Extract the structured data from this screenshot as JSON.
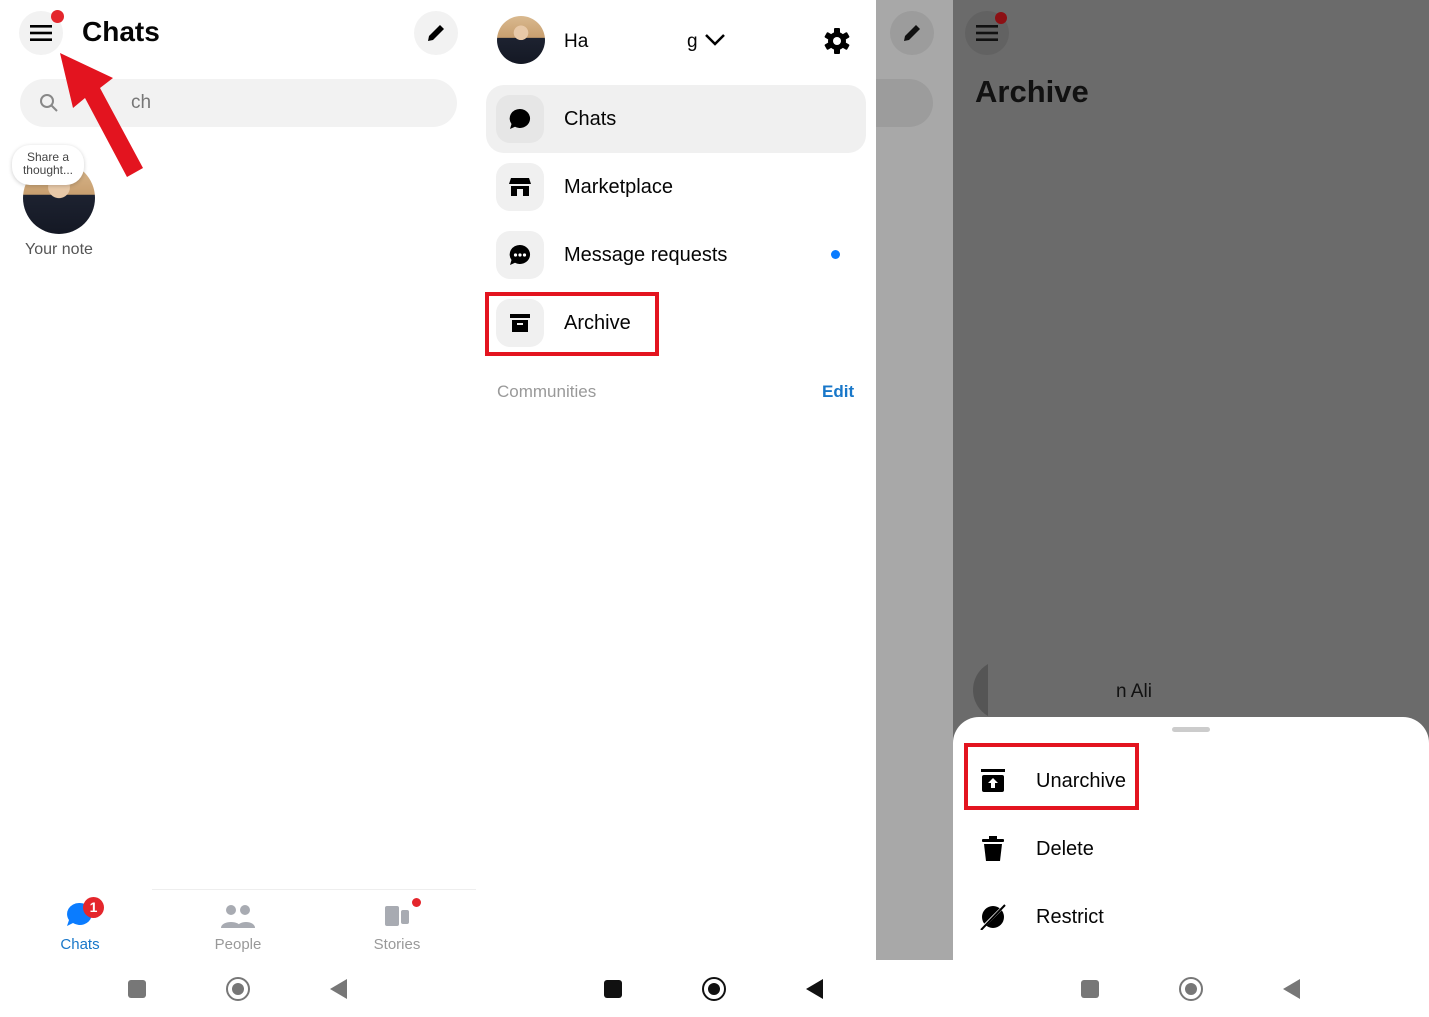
{
  "panel1": {
    "title": "Chats",
    "search_placeholder": "ch",
    "note_bubble": "Share a thought...",
    "note_label": "Your note",
    "tabs": [
      {
        "label": "Chats",
        "badge": "1",
        "active": true
      },
      {
        "label": "People"
      },
      {
        "label": "Stories",
        "dot": true
      }
    ],
    "colors": {
      "accent": "#0a7cff",
      "badge": "#e4262c",
      "annotation": "#e3141f"
    }
  },
  "panel2": {
    "user_name_start": "Ha",
    "user_name_end": "g",
    "menu": [
      {
        "label": "Chats",
        "icon": "chat-bubble-icon",
        "selected": true
      },
      {
        "label": "Marketplace",
        "icon": "store-icon"
      },
      {
        "label": "Message requests",
        "icon": "message-dots-icon",
        "dot": true
      },
      {
        "label": "Archive",
        "icon": "archive-box-icon",
        "highlighted": true
      }
    ],
    "communities_label": "Communities",
    "edit_label": "Edit"
  },
  "panel3": {
    "title": "Archive",
    "contact_partial": "n Ali",
    "sheet": [
      {
        "label": "Unarchive",
        "icon": "unarchive-icon",
        "highlighted": true
      },
      {
        "label": "Delete",
        "icon": "trash-icon"
      },
      {
        "label": "Restrict",
        "icon": "restrict-icon"
      }
    ]
  }
}
